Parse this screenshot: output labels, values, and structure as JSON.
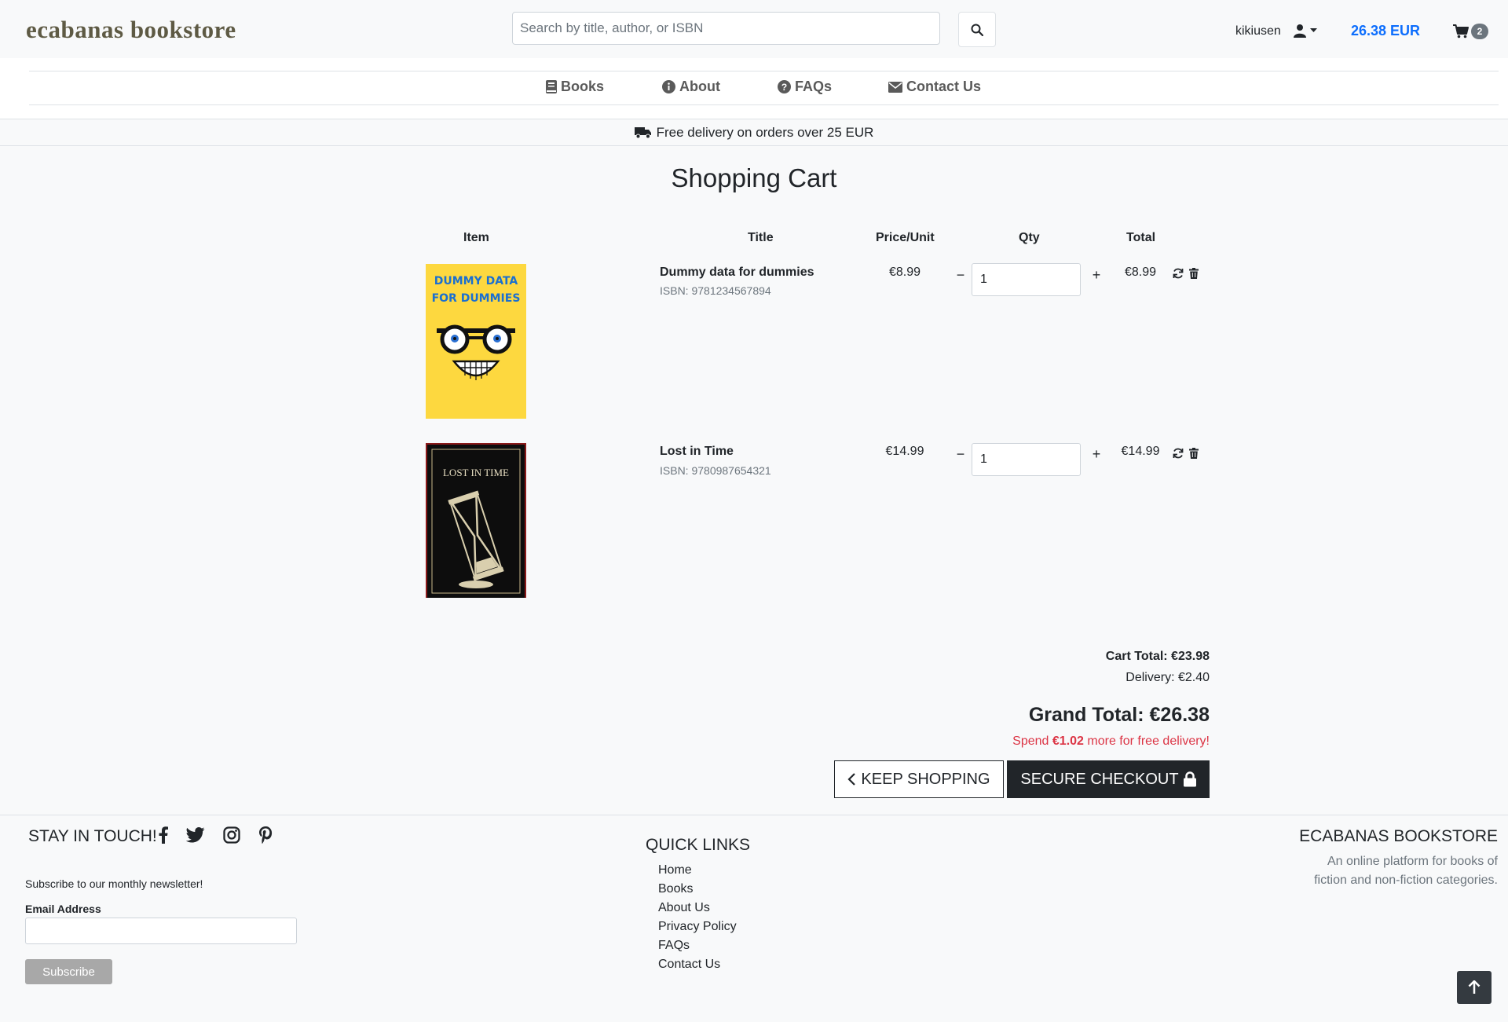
{
  "header": {
    "brand": "ecabanas bookstore",
    "search_placeholder": "Search by title, author, or ISBN",
    "username": "kikiusen",
    "cart_total": "26.38 EUR",
    "cart_count": "2"
  },
  "nav": {
    "books": "Books",
    "about": "About",
    "faqs": "FAQs",
    "contact": "Contact Us"
  },
  "promo": "Free delivery on orders over 25 EUR",
  "cart": {
    "title": "Shopping Cart",
    "headers": {
      "item": "Item",
      "title": "Title",
      "price": "Price/Unit",
      "qty": "Qty",
      "total": "Total"
    },
    "items": [
      {
        "title": "Dummy data for dummies",
        "isbn": "ISBN: 9781234567894",
        "price": "€8.99",
        "qty": "1",
        "total": "€8.99",
        "cover_text_1": "DUMMY DATA",
        "cover_text_2": "FOR DUMMIES"
      },
      {
        "title": "Lost in Time",
        "isbn": "ISBN: 9780987654321",
        "price": "€14.99",
        "qty": "1",
        "total": "€14.99",
        "cover_text_1": "LOST IN TIME"
      }
    ],
    "cart_total": "Cart Total: €23.98",
    "delivery": "Delivery: €2.40",
    "grand_total": "Grand Total: €26.38",
    "spend_prefix": "Spend ",
    "spend_amount": "€1.02",
    "spend_suffix": " more for free delivery!",
    "keep_shopping": "KEEP SHOPPING",
    "checkout": "SECURE CHECKOUT"
  },
  "footer": {
    "stay_heading": "STAY IN TOUCH!",
    "newsletter_text": "Subscribe to our monthly newsletter!",
    "email_label": "Email Address",
    "subscribe": "Subscribe",
    "quick_heading": "QUICK LINKS",
    "links": [
      "Home",
      "Books",
      "About Us",
      "Privacy Policy",
      "FAQs",
      "Contact Us"
    ],
    "about_heading": "ECABANAS BOOKSTORE",
    "about_text": "An online platform for books of fiction and non-fiction categories."
  },
  "colors": {
    "brand": "#5e5a44",
    "accent": "#0d6efd",
    "warning": "#dc3545",
    "dark": "#212529"
  }
}
